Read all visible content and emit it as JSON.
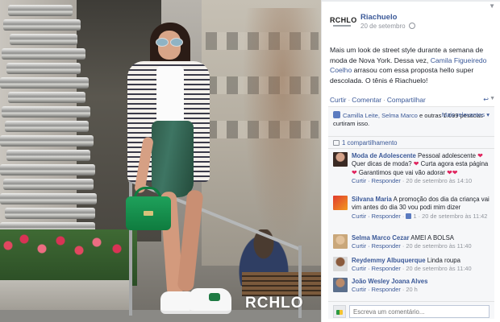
{
  "photo": {
    "watermark": "RCHLO"
  },
  "post": {
    "logo_text": "RCHLO",
    "page_name": "Riachuelo",
    "date": "20 de setembro",
    "caption_1": "Mais um look de street style durante a semana de moda de Nova York. Dessa vez, ",
    "caption_mention": "Camila Figueiredo Coelho",
    "caption_2": " arrasou com essa proposta hello super descolada. O tênis é Riachuelo!",
    "actions": {
      "like": "Curtir",
      "comment": "Comentar",
      "share": "Compartilhar"
    }
  },
  "ufi": {
    "likes_names": "Camilla Leite, Selma Marco",
    "likes_rest": " e outras 1.099 pessoas curtiram isso.",
    "most_relevant": "Mais relevantes",
    "shares": "1 compartilhamento",
    "comments": [
      {
        "author": "Moda de Adolescente",
        "text": " Pessoal adolescente ",
        "text2": " Quer dicas de moda? ",
        "text3": " Curta agora esta página ",
        "text4": " Garantimos que vai vão adorar ",
        "meta_reply": "Curtir · Responder",
        "meta_time": "20 de setembro às 14:10"
      },
      {
        "author": "Silvana Maria",
        "text": " A promoção dos dia da criança vai vim antes do dia 30 vou podi mim dizer",
        "meta_reply": "Curtir · Responder",
        "like_count": "1",
        "meta_time": "20 de setembro às 11:42"
      },
      {
        "author": "Selma Marco Cezar",
        "text": " AMEI A BOLSA",
        "meta_reply": "Curtir · Responder",
        "meta_time": "20 de setembro às 11:40"
      },
      {
        "author": "Reydemmy Albuquerque",
        "text": " Linda roupa",
        "meta_reply": "Curtir · Responder",
        "meta_time": "20 de setembro às 11:40"
      },
      {
        "author": "João Wesley Joana Alves",
        "text": "",
        "meta_reply": "Curtir · Responder",
        "meta_time": "20 h"
      }
    ],
    "compose_placeholder": "Escreva um comentário..."
  }
}
